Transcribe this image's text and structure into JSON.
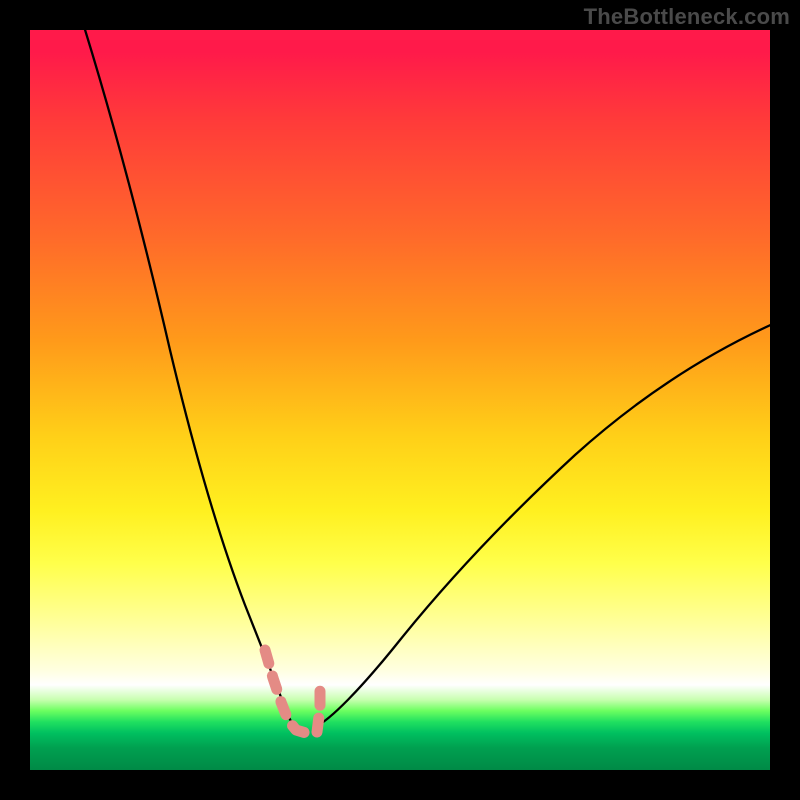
{
  "watermark": "TheBottleneck.com",
  "colors": {
    "page_bg": "#000000",
    "curve": "#000000",
    "valley_marker": "#e48b85",
    "gradient_top": "#ff1a4a",
    "gradient_bottom": "#008a46"
  },
  "chart_data": {
    "type": "line",
    "title": "",
    "xlabel": "",
    "ylabel": "",
    "xlim": [
      0,
      100
    ],
    "ylim": [
      0,
      100
    ],
    "grid": false,
    "background": "rainbow-vertical-gradient (red top → green bottom)",
    "series": [
      {
        "name": "left-branch",
        "x": [
          7,
          10,
          13,
          16,
          19,
          22,
          24,
          26,
          28,
          30,
          31.5,
          33,
          34
        ],
        "y": [
          100,
          85,
          70,
          56,
          43,
          32,
          24,
          18,
          13,
          9.5,
          7.5,
          6.5,
          6
        ]
      },
      {
        "name": "right-branch",
        "x": [
          38,
          40,
          43,
          47,
          52,
          58,
          65,
          73,
          82,
          91,
          100
        ],
        "y": [
          6,
          7.5,
          10,
          13,
          17,
          22,
          28,
          35,
          43,
          51,
          59
        ]
      },
      {
        "name": "valley-marker",
        "style": "dashed-thick-salmon",
        "x": [
          31,
          32,
          33,
          34,
          35,
          36,
          37,
          38,
          38,
          38
        ],
        "y": [
          12,
          10,
          8.5,
          7,
          6,
          5.5,
          5.3,
          5.3,
          8,
          11
        ]
      }
    ],
    "notes": "Axes are unlabeled in the source image; x and y are read on a 0–100 normalized scale matching the visible plot square. The curve forms an asymmetric V with its minimum near x≈35, y≈5. A short dashed salmon segment highlights the valley bottom."
  }
}
